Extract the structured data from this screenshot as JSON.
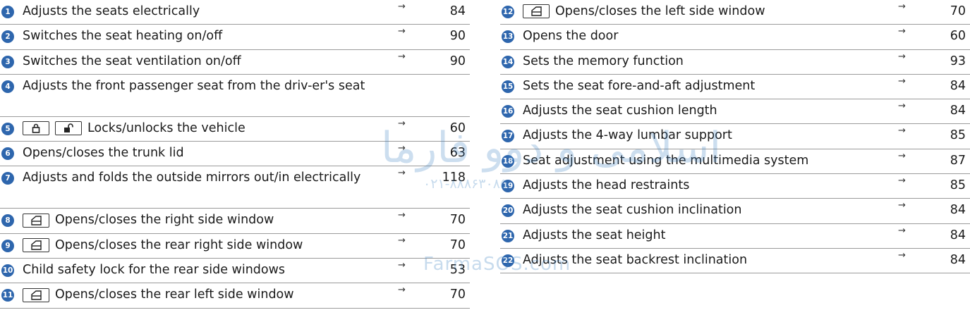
{
  "left": [
    {
      "n": "1",
      "text": "Adjusts the seats electrically",
      "page": "84"
    },
    {
      "n": "2",
      "text": "Switches the seat heating on/off",
      "page": "90"
    },
    {
      "n": "3",
      "text": "Switches the seat ventilation on/off",
      "page": "90"
    },
    {
      "n": "4",
      "text": "Adjusts the front passenger seat from the driv-er's seat",
      "page": ""
    },
    {
      "n": "5",
      "text": "Locks/unlocks the vehicle",
      "page": "60",
      "icons": [
        "lock-icon",
        "unlock-icon"
      ]
    },
    {
      "n": "6",
      "text": "Opens/closes the trunk lid",
      "page": "63"
    },
    {
      "n": "7",
      "text": "Adjusts and folds the outside mirrors out/in electrically",
      "page": "118"
    },
    {
      "n": "8",
      "text": "Opens/closes the right side window",
      "page": "70",
      "icons": [
        "window-switch-icon"
      ]
    },
    {
      "n": "9",
      "text": "Opens/closes the rear right side window",
      "page": "70",
      "icons": [
        "window-switch-icon"
      ]
    },
    {
      "n": "10",
      "text": "Child safety lock for the rear side windows",
      "page": "53"
    },
    {
      "n": "11",
      "text": "Opens/closes the rear left side window",
      "page": "70",
      "icons": [
        "window-switch-icon"
      ]
    }
  ],
  "right": [
    {
      "n": "12",
      "text": "Opens/closes the left side window",
      "page": "70",
      "icons": [
        "window-switch-icon"
      ]
    },
    {
      "n": "13",
      "text": "Opens the door",
      "page": "60"
    },
    {
      "n": "14",
      "text": "Sets the memory function",
      "page": "93"
    },
    {
      "n": "15",
      "text": "Sets the seat fore-and-aft adjustment",
      "page": "84"
    },
    {
      "n": "16",
      "text": "Adjusts the seat cushion length",
      "page": "84"
    },
    {
      "n": "17",
      "text": "Adjusts the 4-way lumbar support",
      "page": "85"
    },
    {
      "n": "18",
      "text": "Seat adjustment using the multimedia system",
      "page": "87"
    },
    {
      "n": "19",
      "text": "Adjusts the head restraints",
      "page": "85"
    },
    {
      "n": "20",
      "text": "Adjusts the seat cushion inclination",
      "page": "84"
    },
    {
      "n": "21",
      "text": "Adjusts the seat height",
      "page": "84"
    },
    {
      "n": "22",
      "text": "Adjusts the seat backrest inclination",
      "page": "84"
    }
  ],
  "arrow_glyph": "→",
  "watermarks": {
    "brand_fa": "اسلامی و دوو فارما",
    "phone": "۰۲۱-۸۸۸۶۳۰۸۵",
    "site": "FarmaSOS.com"
  },
  "colors": {
    "accent": "#2e66ad",
    "rule": "#9a9a9a",
    "watermark": "#3a7fc1"
  }
}
